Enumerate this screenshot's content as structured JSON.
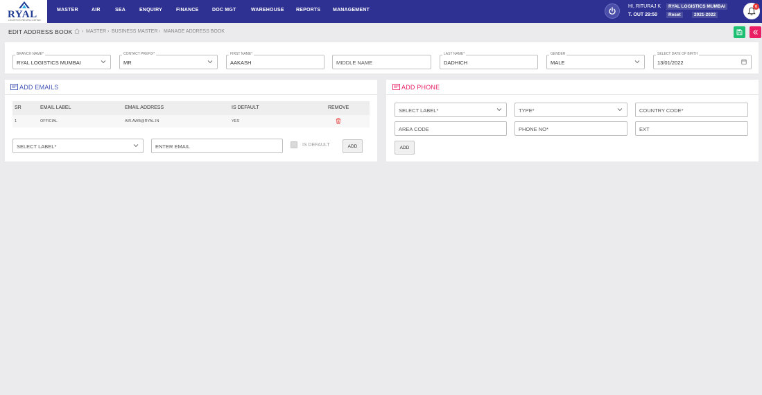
{
  "app": {
    "logo_text": "RYAL",
    "logo_subtext": "LOGISTICS PRIVATE LIMITED"
  },
  "nav": {
    "items": [
      "MASTER",
      "AIR",
      "SEA",
      "ENQUIRY",
      "FINANCE",
      "DOC MGT",
      "WAREHOUSE",
      "REPORTS",
      "MANAGEMENT"
    ]
  },
  "user": {
    "greeting": "HI, RITURAJ K",
    "timeout": "T. OUT 29:50",
    "company": "RYAL LOGISTICS MUMBAI",
    "reset_label": "Reset",
    "year": "2021-2022",
    "notification_count": "0"
  },
  "page": {
    "title": "EDIT ADDRESS BOOK",
    "breadcrumb": [
      "MASTER",
      "BUSINESS MASTER",
      "MANAGE ADDRESS BOOK"
    ]
  },
  "form": {
    "branch": {
      "label": "BRANCH NAME*",
      "value": "RYAL LOGISTICS MUMBAI"
    },
    "prefix": {
      "label": "CONTACT PREFIX*",
      "value": "MR"
    },
    "first_name": {
      "label": "FIRST NAME*",
      "value": "AAKASH"
    },
    "middle_name": {
      "placeholder": "MIDDLE NAME"
    },
    "last_name": {
      "label": "LAST NAME*",
      "value": "DADHICH"
    },
    "gender": {
      "label": "GENDER",
      "value": "MALE"
    },
    "dob": {
      "label": "SELECT DATE OF BIRTH",
      "value": "13/01/2022"
    }
  },
  "emails": {
    "title": "ADD EMAILS",
    "columns": [
      "SR",
      "EMAIL LABEL",
      "EMAIL ADDRESS",
      "IS DEFAULT",
      "REMOVE"
    ],
    "rows": [
      {
        "sr": "1",
        "label": "OFFICIAL",
        "address": "AIR.AWB@RYAL.IN",
        "is_default": "YES"
      }
    ],
    "select_label_placeholder": "SELECT LABEL*",
    "email_placeholder": "ENTER EMAIL",
    "is_default_label": "IS DEFAULT",
    "add_label": "ADD"
  },
  "phone": {
    "title": "ADD PHONE",
    "select_label_placeholder": "SELECT LABEL*",
    "type_placeholder": "TYPE*",
    "country_code_placeholder": "COUNTRY CODE*",
    "area_code_placeholder": "AREA CODE",
    "phone_no_placeholder": "PHONE NO*",
    "ext_placeholder": "EXT",
    "add_label": "ADD"
  },
  "colors": {
    "nav_bg": "#2e3192",
    "email_accent": "#3f51b5",
    "phone_accent": "#e91e63",
    "save_green": "#1dbf73",
    "collapse_pink": "#e91e63"
  }
}
